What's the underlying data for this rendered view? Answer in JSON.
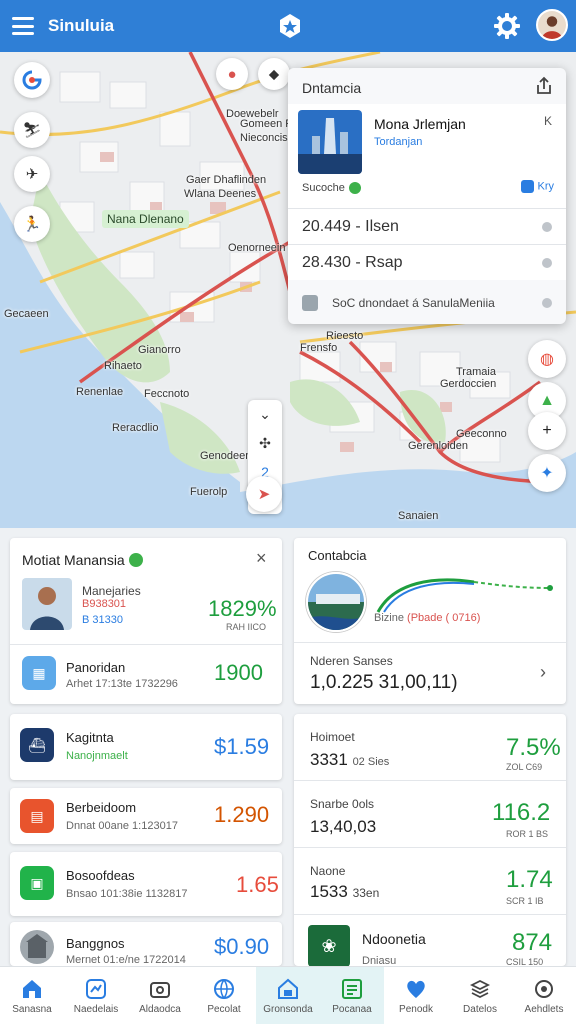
{
  "app": {
    "title": "Sinuluia"
  },
  "map": {
    "labels": [
      "Gomeen Paiten",
      "Nieconcis",
      "Gaer Dhaflinden",
      "Oenorneein",
      "Gecaeen",
      "Gianorro",
      "Rihaeto",
      "Renenlae",
      "Feccnoto",
      "Reracdlio",
      "Genodeen",
      "Fuerolp",
      "Frensfo",
      "Tramaia",
      "Gerdoccien",
      "Geeconno",
      "Gerenloiden",
      "Sanaien",
      "Wlana Deenes",
      "Doewebelr",
      "Rieesto"
    ],
    "chip": "Nana Dlenano"
  },
  "popup": {
    "title": "Dntamcia",
    "place_name": "Mona Jrlemjan",
    "place_sub": "Tordanjan",
    "close_text": "K",
    "status_text": "Sucoche",
    "chip_text": "Kry",
    "row1": "20.449 - Ilsen",
    "row2": "28.430 - Rsap",
    "footer": "SoC dnondaet á SanulaMeniia"
  },
  "left_top": {
    "title": "Motiat Manansia",
    "person_label": "Manejaries",
    "person_red": "B938301",
    "person_blue": "B 31330",
    "person_pct": "1829%",
    "person_small": "RAH IICO",
    "item_label": "Panoridan",
    "item_sub": "Arhet 17:13te 1732296",
    "item_value": "1900"
  },
  "right_top": {
    "title": "Contabcia",
    "route_label": "Bizine",
    "route_red": "(Pbade ( 0716)",
    "totals_label": "Nderen Sanses",
    "totals_value": "1,0.225 31,00,11)"
  },
  "left_list": [
    {
      "label": "Kagitnta",
      "sub": "Nanojnmaelt",
      "value": "$1.59",
      "color": "#2a7de1",
      "sub_color": "#3db14a"
    },
    {
      "label": "Berbeidoom",
      "sub": "Dnnat 00ane 1:123017",
      "value": "1.290",
      "color": "#d35400",
      "sub_color": "#666"
    },
    {
      "label": "Bosoofdeas",
      "sub": "Bnsao 101:38ie 1132817",
      "value": "1.65",
      "color": "#e74c3c",
      "sub_color": "#666"
    },
    {
      "label": "Banggnos",
      "sub": "Mernet 01:e/ne 1722014",
      "value": "$0.90",
      "color": "#2a7de1",
      "sub_color": "#666"
    }
  ],
  "right_list": [
    {
      "label": "Hoimoet",
      "value": "3331",
      "value_small": "02 Sies",
      "pct": "7.5%",
      "pct_small": "ZOL C69",
      "pct_color": "#1e9e3e"
    },
    {
      "label": "Snarbe 0ols",
      "value": "13,40,03",
      "value_small": "",
      "pct": "116.2",
      "pct_small": "ROR 1 BS",
      "pct_color": "#1e9e3e"
    },
    {
      "label": "Naone",
      "value": "1533",
      "value_small": "33en",
      "pct": "1.74",
      "pct_small": "SCR 1 IB",
      "pct_color": "#1e9e3e"
    },
    {
      "label": "Ndoonetia",
      "value": "",
      "value_small": "Dniasu",
      "pct": "874",
      "pct_small": "CSIL 150",
      "pct_color": "#1e9e3e"
    }
  ],
  "nav": [
    {
      "label": "Sanasna",
      "icon": "home-icon",
      "active": false
    },
    {
      "label": "Naedelais",
      "icon": "chart-icon",
      "active": false
    },
    {
      "label": "Aldaodca",
      "icon": "camera-icon",
      "active": false
    },
    {
      "label": "Pecolat",
      "icon": "globe-icon",
      "active": false
    },
    {
      "label": "Gronsonda",
      "icon": "house-icon",
      "active": true
    },
    {
      "label": "Pocanaa",
      "icon": "list-icon",
      "active": true
    },
    {
      "label": "Penodk",
      "icon": "heart-icon",
      "active": false
    },
    {
      "label": "Datelos",
      "icon": "layers-icon",
      "active": false
    },
    {
      "label": "Aehdlets",
      "icon": "settings-icon",
      "active": false
    }
  ],
  "colors": {
    "accent": "#2f7fd6",
    "green": "#1e9e3e",
    "red": "#d9534f",
    "blue": "#2a7de1"
  }
}
